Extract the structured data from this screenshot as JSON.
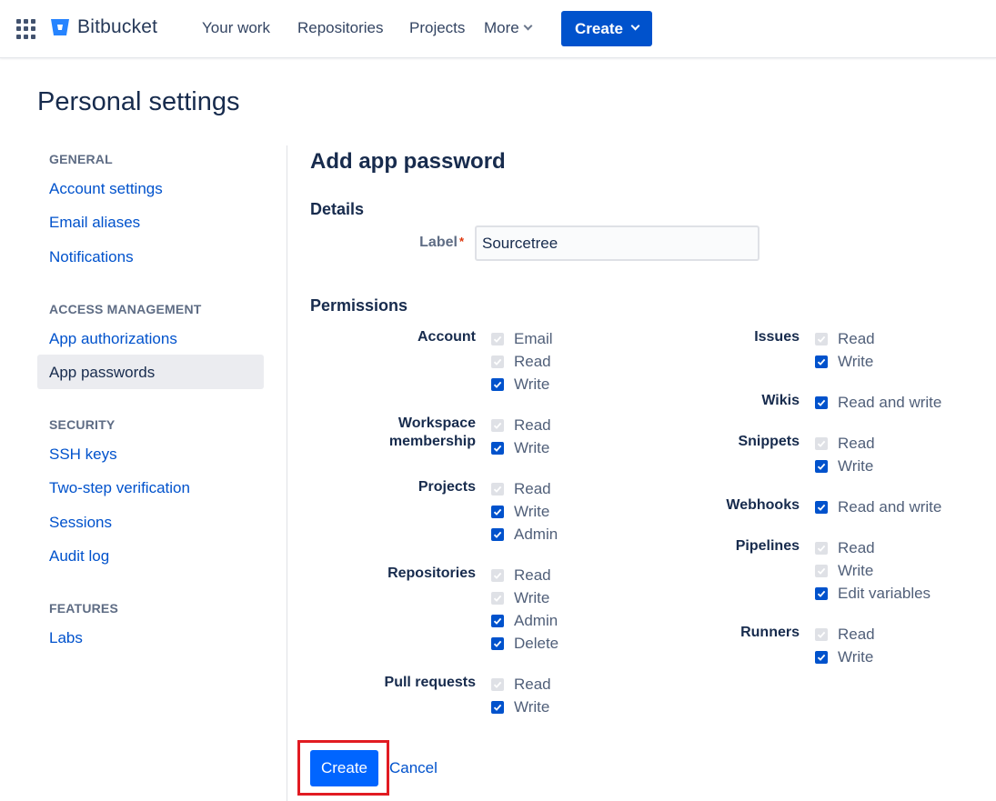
{
  "nav": {
    "brand": "Bitbucket",
    "items": [
      "Your work",
      "Repositories",
      "Projects",
      "More"
    ],
    "create_label": "Create"
  },
  "page": {
    "title": "Personal settings"
  },
  "sidebar": {
    "general_heading": "GENERAL",
    "account_settings": "Account settings",
    "email_aliases": "Email aliases",
    "notifications": "Notifications",
    "access_heading": "ACCESS MANAGEMENT",
    "app_authorizations": "App authorizations",
    "app_passwords": "App passwords",
    "security_heading": "SECURITY",
    "ssh_keys": "SSH keys",
    "two_step": "Two-step verification",
    "sessions": "Sessions",
    "audit_log": "Audit log",
    "features_heading": "FEATURES",
    "labs": "Labs"
  },
  "main": {
    "heading": "Add app password",
    "details_heading": "Details",
    "label_field_label": "Label",
    "label_required_marker": "*",
    "label_value": "Sourcetree",
    "permissions_heading": "Permissions",
    "groups": {
      "account": {
        "label": "Account",
        "options": [
          "Email",
          "Read",
          "Write"
        ],
        "state": [
          "disabled-checked",
          "disabled-checked",
          "checked"
        ]
      },
      "workspace": {
        "label_line1": "Workspace",
        "label_line2": "membership",
        "options": [
          "Read",
          "Write"
        ],
        "state": [
          "disabled-checked",
          "checked"
        ]
      },
      "projects": {
        "label": "Projects",
        "options": [
          "Read",
          "Write",
          "Admin"
        ],
        "state": [
          "disabled-checked",
          "checked",
          "checked"
        ]
      },
      "repositories": {
        "label": "Repositories",
        "options": [
          "Read",
          "Write",
          "Admin",
          "Delete"
        ],
        "state": [
          "disabled-checked",
          "disabled-checked",
          "checked",
          "checked"
        ]
      },
      "pull_requests": {
        "label": "Pull requests",
        "options": [
          "Read",
          "Write"
        ],
        "state": [
          "disabled-checked",
          "checked"
        ]
      },
      "issues": {
        "label": "Issues",
        "options": [
          "Read",
          "Write"
        ],
        "state": [
          "disabled-checked",
          "checked"
        ]
      },
      "wikis": {
        "label": "Wikis",
        "options": [
          "Read and write"
        ],
        "state": [
          "checked"
        ]
      },
      "snippets": {
        "label": "Snippets",
        "options": [
          "Read",
          "Write"
        ],
        "state": [
          "disabled-checked",
          "checked"
        ]
      },
      "webhooks": {
        "label": "Webhooks",
        "options": [
          "Read and write"
        ],
        "state": [
          "checked"
        ]
      },
      "pipelines": {
        "label": "Pipelines",
        "options": [
          "Read",
          "Write",
          "Edit variables"
        ],
        "state": [
          "disabled-checked",
          "disabled-checked",
          "checked"
        ]
      },
      "runners": {
        "label": "Runners",
        "options": [
          "Read",
          "Write"
        ],
        "state": [
          "disabled-checked",
          "checked"
        ]
      }
    },
    "create_label": "Create",
    "cancel_label": "Cancel"
  },
  "colors": {
    "primary": "#0052CC",
    "highlight": "#E11B22"
  }
}
